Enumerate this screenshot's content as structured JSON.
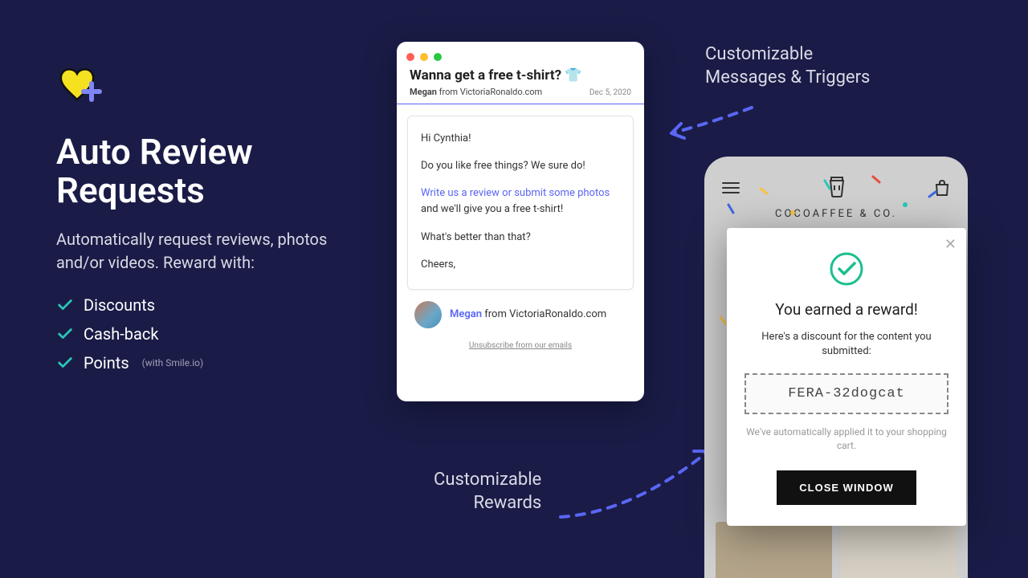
{
  "left": {
    "title_line1": "Auto Review",
    "title_line2": "Requests",
    "subtitle": "Automatically request reviews, photos and/or videos. Reward with:",
    "bullets": [
      {
        "label": "Discounts",
        "sub": ""
      },
      {
        "label": "Cash-back",
        "sub": ""
      },
      {
        "label": "Points",
        "sub": "(with Smile.io)"
      }
    ]
  },
  "email": {
    "subject": "Wanna get a free t-shirt? 👕",
    "from_name": "Megan",
    "from_domain": "from VictoriaRonaldo.com",
    "date": "Dec 5, 2020",
    "greeting": "Hi Cynthia!",
    "line1": "Do you like free things? We sure do!",
    "link_text": "Write us a review or submit some photos",
    "after_link": " and we'll give you a free t-shirt!",
    "line3": "What's better than that?",
    "signoff": "Cheers,",
    "footer_name": "Megan",
    "footer_domain": "from VictoriaRonaldo.com",
    "unsubscribe": "Unsubscribe from our emails"
  },
  "annotations": {
    "top_right": "Customizable\nMessages & Triggers",
    "bottom_center": "Customizable\nRewards"
  },
  "phone": {
    "brand": "COCOAFFEE & CO."
  },
  "reward": {
    "title": "You earned a reward!",
    "subtitle": "Here's a discount for the content you submitted:",
    "code": "FERA-32dogcat",
    "applied": "We've automatically applied it to your shopping cart.",
    "button": "CLOSE WINDOW"
  }
}
